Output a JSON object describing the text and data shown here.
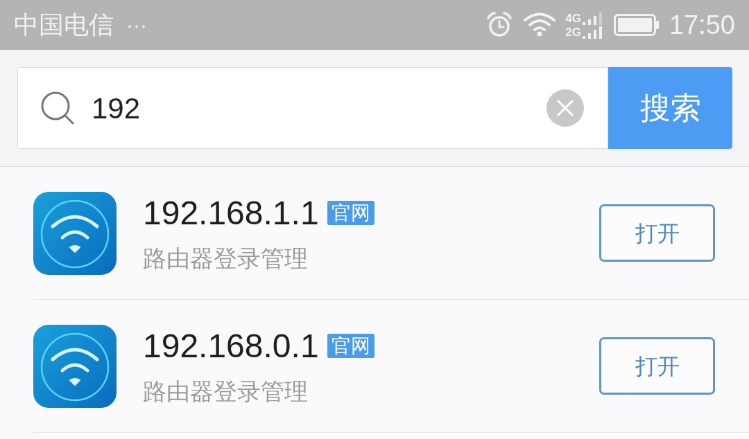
{
  "status_bar": {
    "carrier": "中国电信",
    "more": "···",
    "network_labels": [
      "4G",
      "2G"
    ],
    "time": "17:50"
  },
  "search": {
    "value": "192",
    "button": "搜索"
  },
  "results": [
    {
      "title": "192.168.1.1",
      "badge": "官网",
      "subtitle": "路由器登录管理",
      "action": "打开"
    },
    {
      "title": "192.168.0.1",
      "badge": "官网",
      "subtitle": "路由器登录管理",
      "action": "打开"
    }
  ]
}
